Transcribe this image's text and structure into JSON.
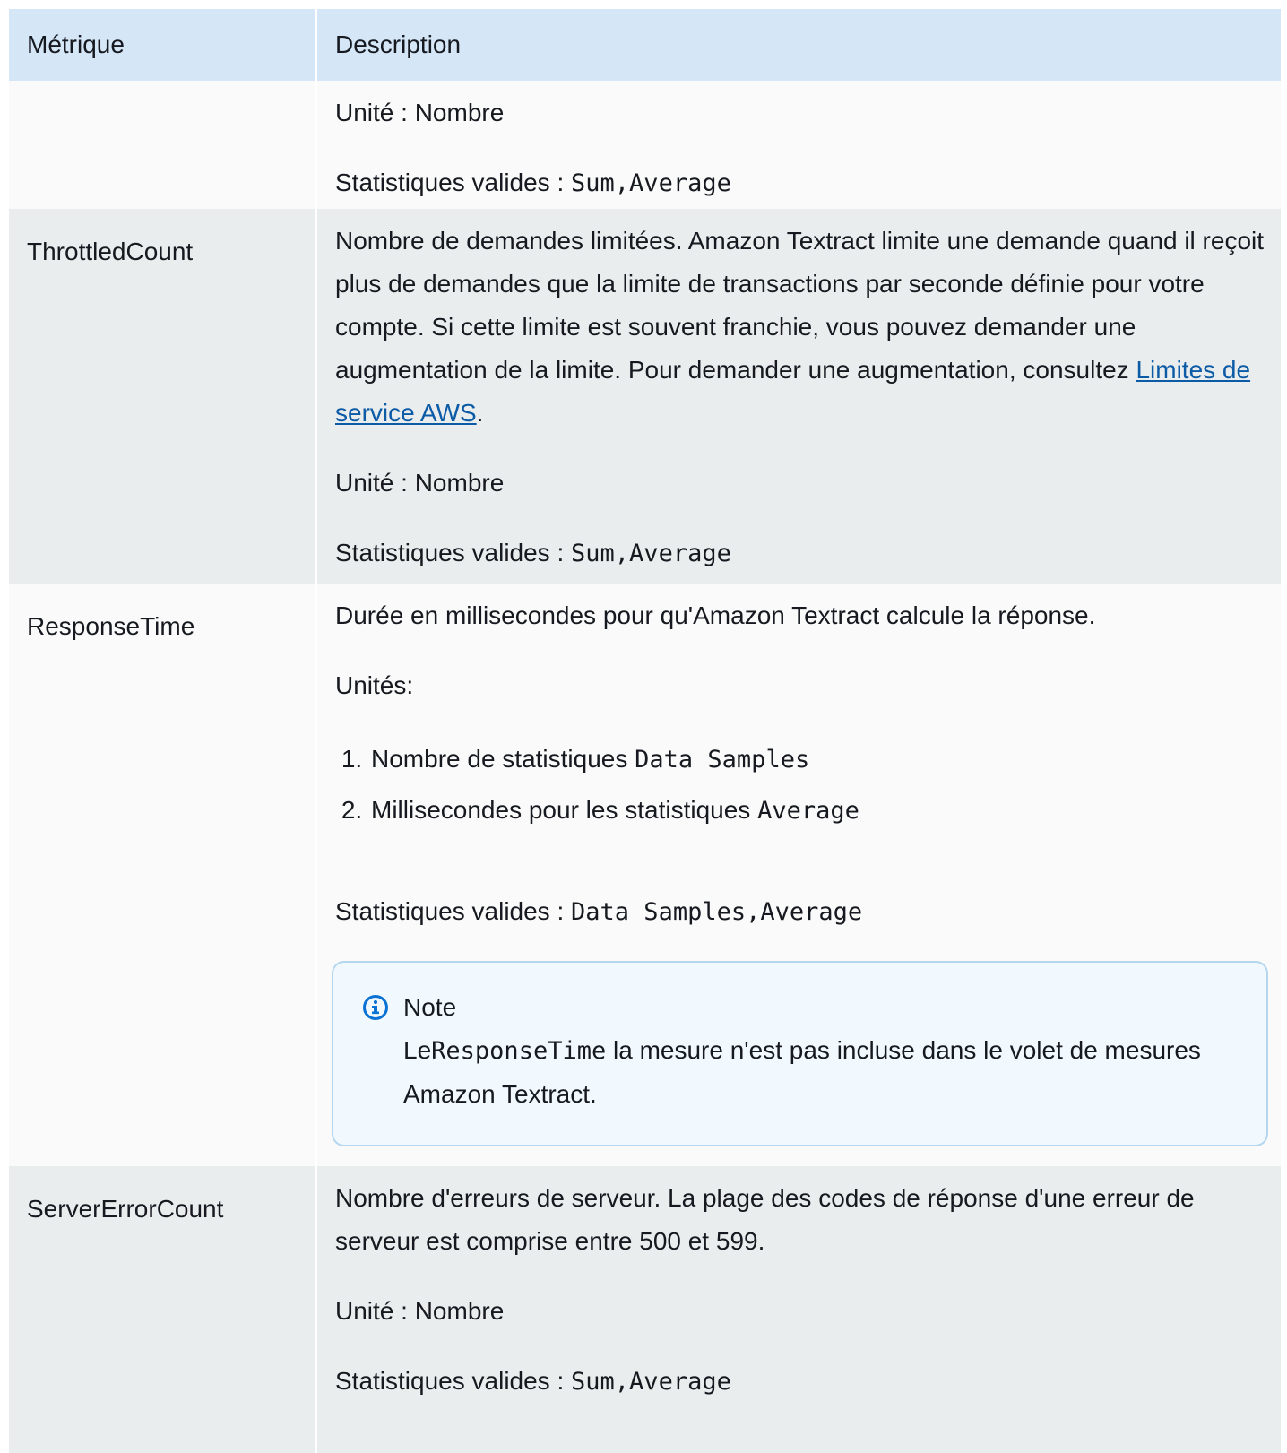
{
  "header": {
    "col1": "Métrique",
    "col2": "Description"
  },
  "rows": [
    {
      "metric": "",
      "unit": "Unité : Nombre",
      "stats_prefix": "Statistiques valides : ",
      "stats_code": "Sum,Average"
    },
    {
      "metric": "ThrottledCount",
      "desc_text": "Nombre de demandes limitées. Amazon Textract limite une demande quand il reçoit plus de demandes que la limite de transactions par seconde définie pour votre compte. Si cette limite est souvent franchie, vous pouvez demander une augmentation de la limite. Pour demander une augmentation, consultez ",
      "link_text": "Limites de service AWS",
      "desc_end": ".",
      "unit": "Unité : Nombre",
      "stats_prefix": "Statistiques valides : ",
      "stats_code": "Sum,Average"
    },
    {
      "metric": "ResponseTime",
      "desc_text": "Durée en millisecondes pour qu'Amazon Textract calcule la réponse.",
      "units_label": "Unités:",
      "list": [
        {
          "text": "Nombre de statistiques ",
          "code": "Data Samples"
        },
        {
          "text": "Millisecondes pour les statistiques ",
          "code": "Average"
        }
      ],
      "stats_prefix": "Statistiques valides : ",
      "stats_code": "Data Samples,Average",
      "note": {
        "title": "Note",
        "prefix": "Le",
        "code": "ResponseTime",
        "text": " la mesure n'est pas incluse dans le volet de mesures Amazon Textract.",
        "icon": "info-icon"
      }
    },
    {
      "metric": "ServerErrorCount",
      "desc_text": "Nombre d'erreurs de serveur. La plage des codes de réponse d'une erreur de serveur est comprise entre 500 et 599.",
      "unit": "Unité : Nombre",
      "stats_prefix": "Statistiques valides : ",
      "stats_code": "Sum,Average"
    }
  ],
  "colors": {
    "header_bg": "#d5e6f7",
    "row_light": "#fafafa",
    "row_dark": "#eaeded",
    "link": "#0c5ba6",
    "note_border": "#b4d6ef",
    "note_bg": "#f1f8fe",
    "info_icon": "#0972d3"
  }
}
